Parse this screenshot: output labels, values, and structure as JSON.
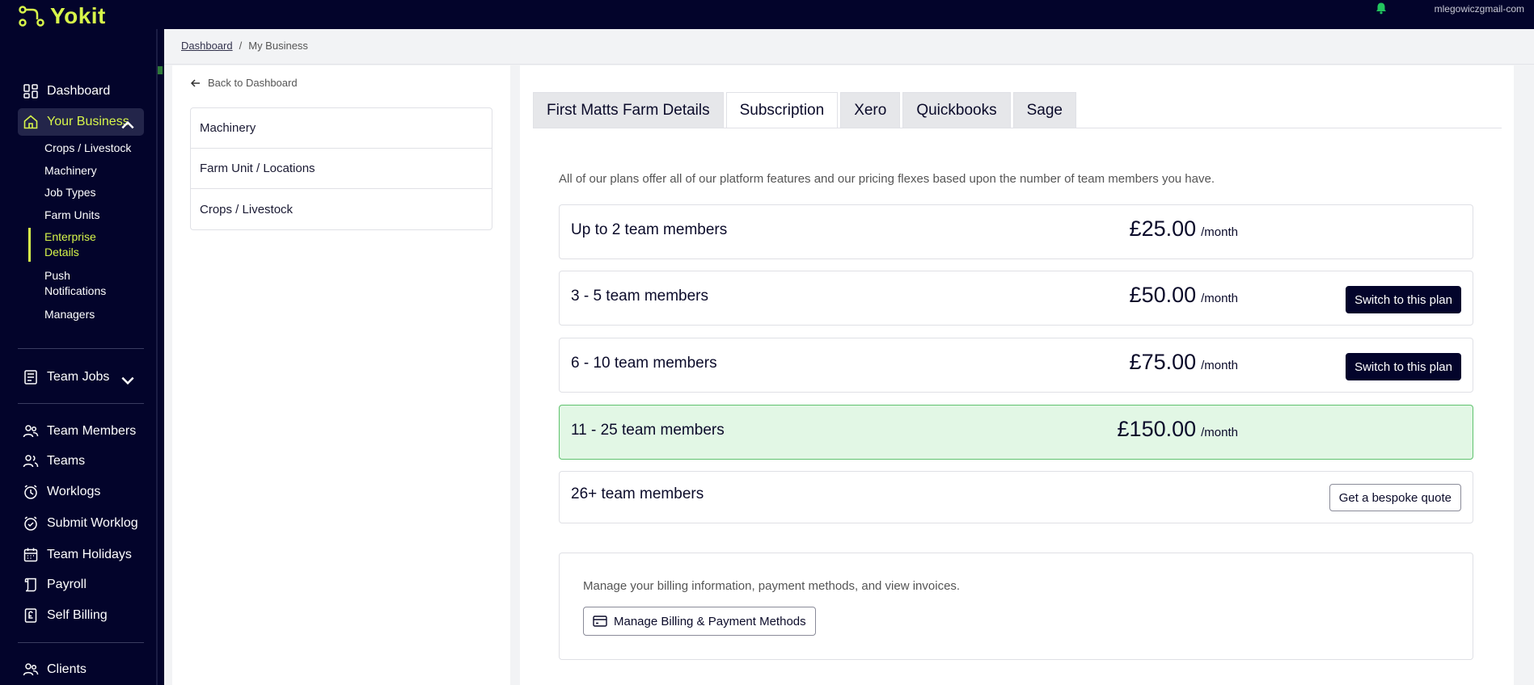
{
  "app": {
    "logo_text": "Yokit",
    "user_email": "mlegowiczgmail-com"
  },
  "colors": {
    "navy": "#03042b",
    "accent": "#d7f54a",
    "current_plan_bg": "#e2f7e5",
    "current_plan_border": "#5fc26e"
  },
  "sidebar": {
    "dashboard": "Dashboard",
    "your_business": "Your Business",
    "sub_items": [
      "Crops / Livestock",
      "Machinery",
      "Job Types",
      "Farm Units",
      "Enterprise Details",
      "Push Notifications",
      "Managers"
    ],
    "team_jobs": "Team Jobs",
    "team_members": "Team Members",
    "teams": "Teams",
    "worklogs": "Worklogs",
    "submit_worklog": "Submit Worklog",
    "team_holidays": "Team Holidays",
    "payroll": "Payroll",
    "self_billing": "Self Billing",
    "clients": "Clients"
  },
  "breadcrumb": {
    "home": "Dashboard",
    "separator": "/",
    "current": "My Business"
  },
  "left_panel": {
    "back_label": "Back to Dashboard",
    "items": [
      "Machinery",
      "Farm Unit / Locations",
      "Crops / Livestock"
    ]
  },
  "tabs": [
    "First Matts Farm Details",
    "Subscription",
    "Xero",
    "Quickbooks",
    "Sage"
  ],
  "subscription": {
    "intro": "All of our plans offer all of our platform features and our pricing flexes based upon the number of team members you have.",
    "period": "/month",
    "switch_label": "Switch to this plan",
    "plans": [
      {
        "name": "Up to 2 team members",
        "price": "£25.00"
      },
      {
        "name": "3 - 5 team members",
        "price": "£50.00"
      },
      {
        "name": "6 - 10 team members",
        "price": "£75.00"
      },
      {
        "name": "11 - 25 team members",
        "price": "£150.00"
      },
      {
        "name": "26+ team members"
      }
    ],
    "quote_label": "Get a bespoke quote",
    "billing_text": "Manage your billing information, payment methods, and view invoices.",
    "billing_button": "Manage Billing & Payment Methods"
  }
}
